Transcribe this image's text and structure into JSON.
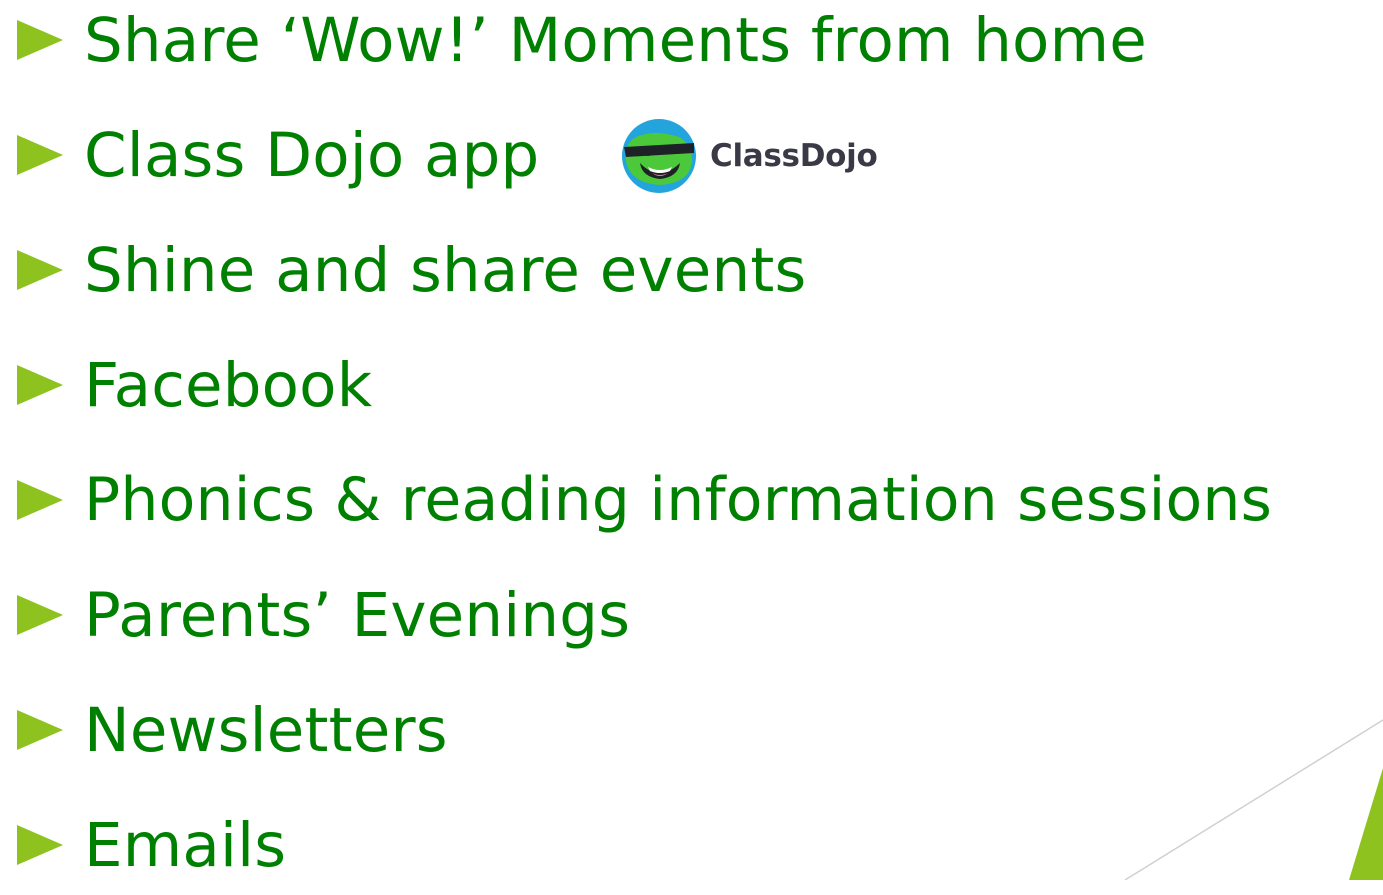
{
  "colors": {
    "text": "#008000",
    "bullet": "#8dc21f",
    "accent_shape": "#8dc21f",
    "decor_line": "#cfcfcf"
  },
  "bullet_icon": "right-triangle-arrow",
  "items": [
    {
      "text": "Share ‘Wow!’ Moments from home"
    },
    {
      "text": "Class Dojo app"
    },
    {
      "text": "Shine and share events"
    },
    {
      "text": "Facebook"
    },
    {
      "text": "Phonics & reading information sessions"
    },
    {
      "text": "Parents’ Evenings"
    },
    {
      "text": "Newsletters"
    },
    {
      "text": "Emails"
    }
  ],
  "classdojo_logo": {
    "icon": "classdojo-monster-icon",
    "text": "ClassDojo"
  }
}
